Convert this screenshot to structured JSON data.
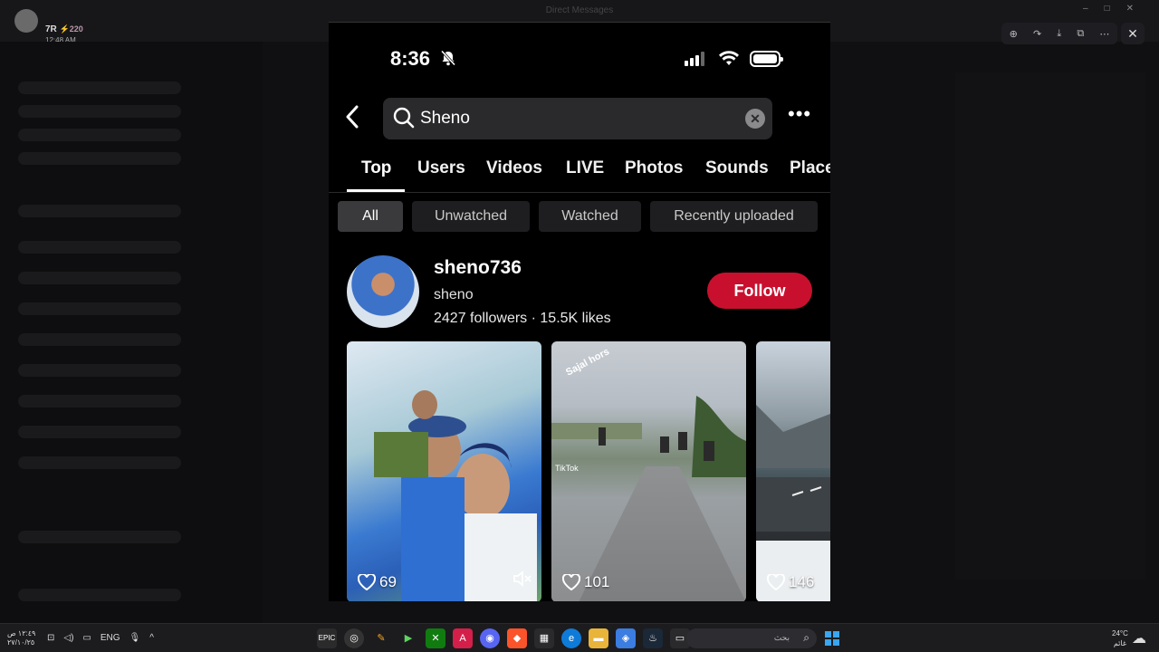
{
  "background": {
    "window_title": "Direct Messages",
    "user_name": "7R",
    "user_badge": "⚡220",
    "user_time": "12:48 AM",
    "viewer_controls": [
      "⊕",
      "↷",
      "⤓",
      "⧉",
      "⋯"
    ],
    "viewer_close": "✕"
  },
  "phone": {
    "status": {
      "time": "8:36"
    },
    "search": {
      "query": "Sheno",
      "clear_label": "✕",
      "more_label": "•••"
    },
    "tabs": [
      "Top",
      "Users",
      "Videos",
      "LIVE",
      "Photos",
      "Sounds",
      "Place"
    ],
    "filters": [
      "All",
      "Unwatched",
      "Watched",
      "Recently uploaded"
    ],
    "profile": {
      "username": "sheno736",
      "nickname": "sheno",
      "stats": "2427 followers · 15.5K likes",
      "follow_label": "Follow"
    },
    "videos": [
      {
        "likes": "69",
        "muted": true
      },
      {
        "likes": "101",
        "overlay": "Sajal hors",
        "watermark": "TikTok"
      },
      {
        "likes": "146"
      }
    ],
    "colors": {
      "follow_button": "#c8102e",
      "background": "#000000"
    }
  },
  "taskbar": {
    "clock_time": "١٢:٤٩ ص",
    "clock_date": "٢٧/١٠/٢٥",
    "lang": "ENG",
    "search_placeholder": "بحث",
    "weather_temp": "24°C",
    "weather_desc": "غائم"
  }
}
